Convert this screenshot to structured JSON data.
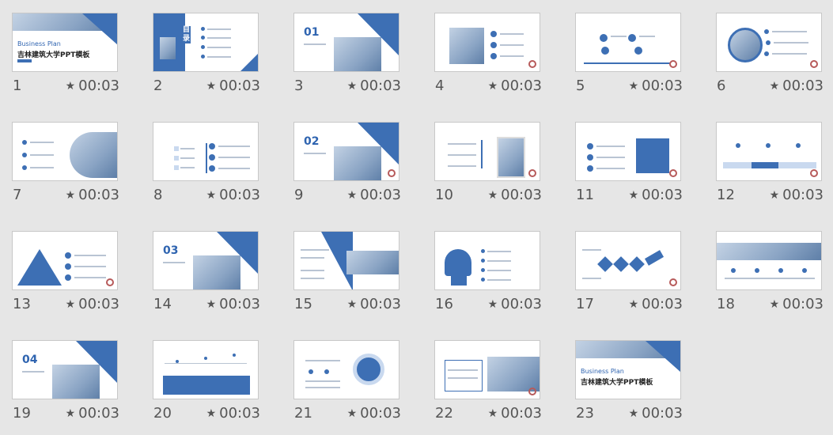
{
  "slides": [
    {
      "num": "1",
      "time": "00:03",
      "business": "Business  Plan",
      "title": "吉林建筑大学PPT模板"
    },
    {
      "num": "2",
      "time": "00:03",
      "toc": "目录"
    },
    {
      "num": "3",
      "time": "00:03",
      "section": "01"
    },
    {
      "num": "4",
      "time": "00:03"
    },
    {
      "num": "5",
      "time": "00:03"
    },
    {
      "num": "6",
      "time": "00:03"
    },
    {
      "num": "7",
      "time": "00:03"
    },
    {
      "num": "8",
      "time": "00:03"
    },
    {
      "num": "9",
      "time": "00:03",
      "section": "02"
    },
    {
      "num": "10",
      "time": "00:03"
    },
    {
      "num": "11",
      "time": "00:03"
    },
    {
      "num": "12",
      "time": "00:03"
    },
    {
      "num": "13",
      "time": "00:03"
    },
    {
      "num": "14",
      "time": "00:03",
      "section": "03"
    },
    {
      "num": "15",
      "time": "00:03"
    },
    {
      "num": "16",
      "time": "00:03"
    },
    {
      "num": "17",
      "time": "00:03"
    },
    {
      "num": "18",
      "time": "00:03"
    },
    {
      "num": "19",
      "time": "00:03",
      "section": "04"
    },
    {
      "num": "20",
      "time": "00:03"
    },
    {
      "num": "21",
      "time": "00:03"
    },
    {
      "num": "22",
      "time": "00:03"
    },
    {
      "num": "23",
      "time": "00:03",
      "business": "Business  Plan",
      "title": "吉林建筑大学PPT模板"
    }
  ],
  "icons": {
    "timer": "star-icon"
  },
  "colors": {
    "accent": "#3d6fb4",
    "background": "#e6e6e6"
  }
}
